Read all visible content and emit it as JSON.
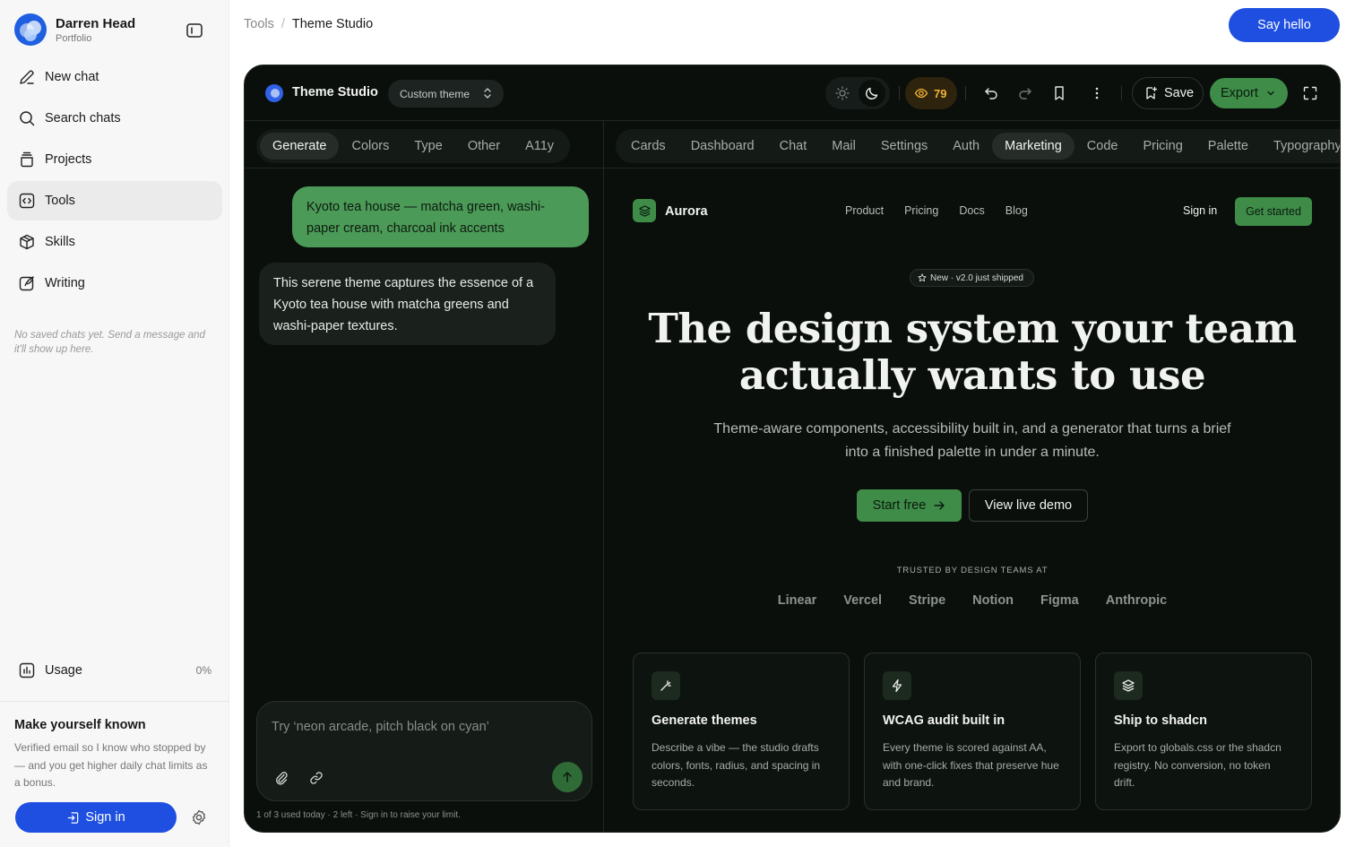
{
  "sidebar": {
    "profile_name": "Darren Head",
    "profile_sub": "Portfolio",
    "nav": [
      {
        "label": "New chat",
        "icon": "pencil-icon"
      },
      {
        "label": "Search chats",
        "icon": "search-icon"
      },
      {
        "label": "Projects",
        "icon": "stack-icon"
      },
      {
        "label": "Tools",
        "icon": "code-icon",
        "active": true
      },
      {
        "label": "Skills",
        "icon": "box-icon"
      },
      {
        "label": "Writing",
        "icon": "quill-icon"
      }
    ],
    "empty_note": "No saved chats yet. Send a message and it'll show up here.",
    "usage_label": "Usage",
    "usage_pct": "0%",
    "signup_title": "Make yourself known",
    "signup_text": "Verified email so I know who stopped by — and you get higher daily chat limits as a bonus.",
    "signin_label": "Sign in"
  },
  "header": {
    "crumb_root": "Tools",
    "crumb_sep": "/",
    "crumb_current": "Theme Studio",
    "say_hello": "Say hello"
  },
  "studio": {
    "title": "Theme Studio",
    "theme_select": "Custom theme",
    "score": "79",
    "save_label": "Save",
    "export_label": "Export",
    "left_tabs": [
      "Generate",
      "Colors",
      "Type",
      "Other",
      "A11y"
    ],
    "left_tab_active": "Generate",
    "right_tabs": [
      "Cards",
      "Dashboard",
      "Chat",
      "Mail",
      "Settings",
      "Auth",
      "Marketing",
      "Code",
      "Pricing",
      "Palette",
      "Typography"
    ],
    "right_tab_active": "Marketing",
    "user_message": "Kyoto tea house — matcha green, washi-paper cream, charcoal ink accents",
    "ai_message": "This serene theme captures the essence of a Kyoto tea house with matcha greens and washi-paper textures.",
    "composer_placeholder": "Try ‘neon arcade, pitch black on cyan’",
    "quota_text": "1 of 3 used today · 2 left · Sign in to raise your limit."
  },
  "preview": {
    "brand": "Aurora",
    "nav": [
      "Product",
      "Pricing",
      "Docs",
      "Blog"
    ],
    "sign_in": "Sign in",
    "get_started": "Get started",
    "pill": "New · v2.0 just shipped",
    "headline": "The design system your team actually wants to use",
    "subhead": "Theme-aware components, accessibility built in, and a generator that turns a brief into a finished palette in under a minute.",
    "start_free": "Start free",
    "view_demo": "View live demo",
    "trusted": "TRUSTED BY DESIGN TEAMS AT",
    "logos": [
      "Linear",
      "Vercel",
      "Stripe",
      "Notion",
      "Figma",
      "Anthropic"
    ],
    "cards": [
      {
        "title": "Generate themes",
        "text": "Describe a vibe — the studio drafts colors, fonts, radius, and spacing in seconds.",
        "icon": "wand-icon"
      },
      {
        "title": "WCAG audit built in",
        "text": "Every theme is scored against AA, with one-click fixes that preserve hue and brand.",
        "icon": "bolt-icon"
      },
      {
        "title": "Ship to shadcn",
        "text": "Export to globals.css or the shadcn registry. No conversion, no token drift.",
        "icon": "layers-icon"
      }
    ]
  },
  "colors": {
    "accent_blue": "#1e4fe0",
    "studio_bg": "#0a0f0b",
    "matcha_green": "#3e8c48",
    "score_amber": "#f1b338"
  }
}
